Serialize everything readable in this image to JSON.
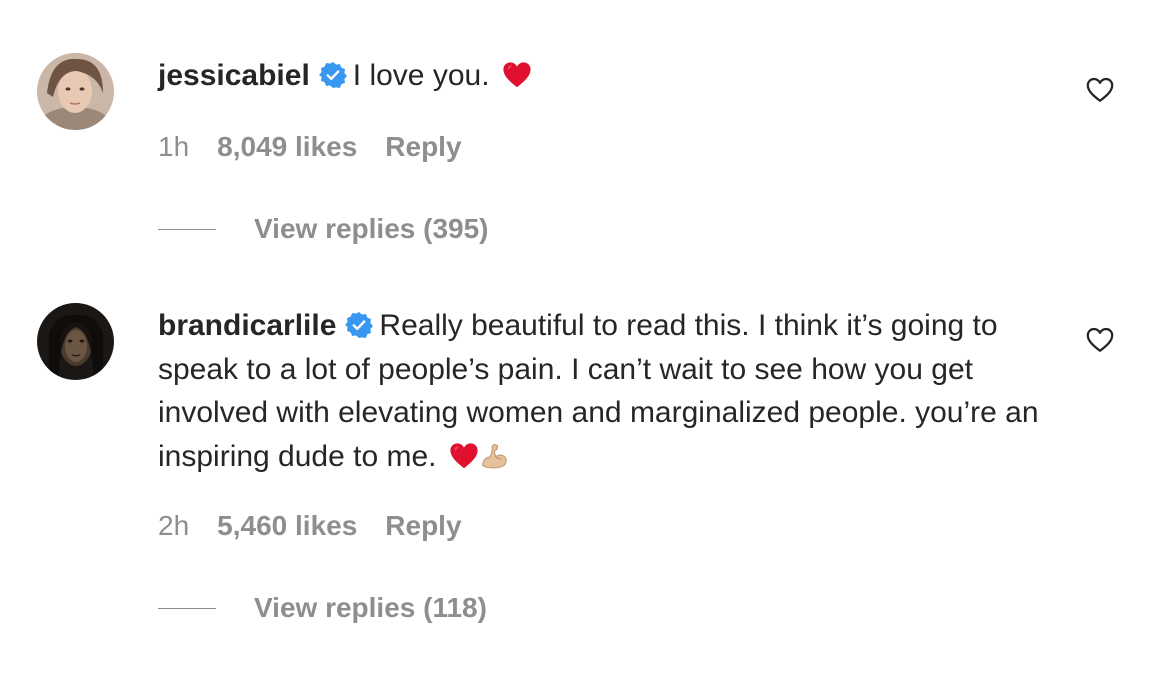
{
  "comments": [
    {
      "username": "jessicabiel",
      "text": "I love you.",
      "time": "1h",
      "likes": "8,049 likes",
      "reply_label": "Reply",
      "view_replies": "View replies (395)",
      "avatar_icon": "profile-photo",
      "emojis": [
        "red-heart"
      ]
    },
    {
      "username": "brandicarlile",
      "text": "Really beautiful to read this. I think it’s going to speak to a lot of people’s pain. I can’t wait to see how you get involved with elevating women and marginalized people. you’re an inspiring dude to me.",
      "time": "2h",
      "likes": "5,460 likes",
      "reply_label": "Reply",
      "view_replies": "View replies (118)",
      "avatar_icon": "profile-photo",
      "emojis": [
        "red-heart",
        "flexed-biceps-light-skin-tone"
      ]
    }
  ],
  "colors": {
    "text_primary": "#262626",
    "text_secondary": "#8e8e8e",
    "verified_blue": "#3897f0",
    "emoji_heart": "#e0102f"
  }
}
